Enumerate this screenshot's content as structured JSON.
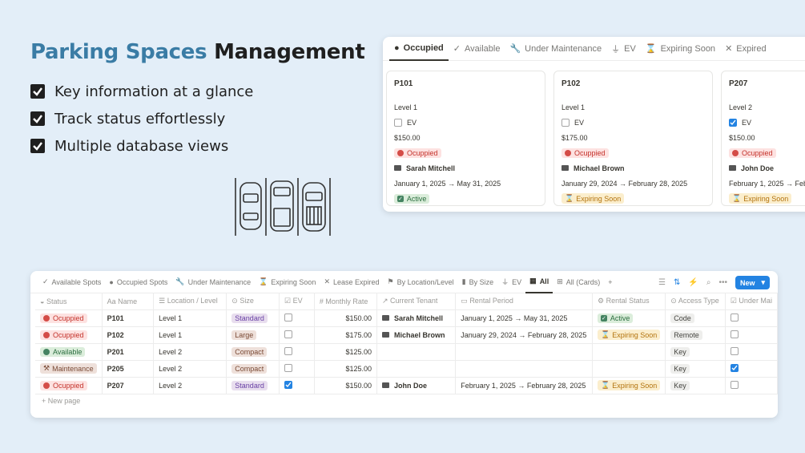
{
  "hero": {
    "title_part1": "Parking Spaces",
    "title_part2": "Management",
    "features": [
      "Key information at a glance",
      "Track status effortlessly",
      "Multiple database views"
    ]
  },
  "board": {
    "tabs": [
      {
        "label": "Occupied",
        "icon": "filled-circle-icon",
        "active": true
      },
      {
        "label": "Available",
        "icon": "check-icon"
      },
      {
        "label": "Under Maintenance",
        "icon": "wrench-icon"
      },
      {
        "label": "EV",
        "icon": "plug-icon"
      },
      {
        "label": "Expiring Soon",
        "icon": "hourglass-icon"
      },
      {
        "label": "Expired",
        "icon": "x-icon"
      }
    ],
    "cards": [
      {
        "name": "P101",
        "level": "Level 1",
        "ev_label": "EV",
        "ev": false,
        "price": "$150.00",
        "status": "Ocuppied",
        "tenant": "Sarah Mitchell",
        "period": "January 1, 2025 → May 31, 2025",
        "rental": "Active"
      },
      {
        "name": "P102",
        "level": "Level 1",
        "ev_label": "EV",
        "ev": false,
        "price": "$175.00",
        "status": "Ocuppied",
        "tenant": "Michael Brown",
        "period": "January 29, 2024 → February 28, 2025",
        "rental": "Expiring Soon"
      },
      {
        "name": "P207",
        "level": "Level 2",
        "ev_label": "EV",
        "ev": true,
        "price": "$150.00",
        "status": "Ocuppied",
        "tenant": "John Doe",
        "period": "February 1, 2025 → Febr",
        "rental": "Expiring Soon"
      }
    ]
  },
  "table": {
    "view_tabs": [
      {
        "label": "Available Spots",
        "icon": "check-icon"
      },
      {
        "label": "Occupied Spots",
        "icon": "filled-circle-icon"
      },
      {
        "label": "Under Maintenance",
        "icon": "wrench-icon"
      },
      {
        "label": "Expiring Soon",
        "icon": "hourglass-icon"
      },
      {
        "label": "Lease Expired",
        "icon": "x-icon"
      },
      {
        "label": "By Location/Level",
        "icon": "flag-icon"
      },
      {
        "label": "By Size",
        "icon": "bar-icon"
      },
      {
        "label": "EV",
        "icon": "plug-icon"
      },
      {
        "label": "All",
        "icon": "table-icon",
        "active": true
      },
      {
        "label": "All (Cards)",
        "icon": "grid-icon"
      }
    ],
    "new_button": "New",
    "columns": [
      "Status",
      "Name",
      "Location / Level",
      "Size",
      "EV",
      "Monthly Rate",
      "Current Tenant",
      "Rental Period",
      "Rental Status",
      "Access Type",
      "Under Mai"
    ],
    "rows": [
      {
        "status": "Ocuppied",
        "status_color": "red",
        "name": "P101",
        "level": "Level 1",
        "size": "Standard",
        "ev": false,
        "rate": "$150.00",
        "tenant": "Sarah Mitchell",
        "period": "January 1, 2025 → May 31, 2025",
        "rental": "Active",
        "access": "Code",
        "maint": false
      },
      {
        "status": "Ocuppied",
        "status_color": "red",
        "name": "P102",
        "level": "Level 1",
        "size": "Large",
        "ev": false,
        "rate": "$175.00",
        "tenant": "Michael Brown",
        "period": "January 29, 2024 → February 28, 2025",
        "rental": "Expiring Soon",
        "access": "Remote",
        "maint": false
      },
      {
        "status": "Available",
        "status_color": "green",
        "name": "P201",
        "level": "Level 2",
        "size": "Compact",
        "ev": false,
        "rate": "$125.00",
        "tenant": "",
        "period": "",
        "rental": "",
        "access": "Key",
        "maint": false
      },
      {
        "status": "Maintenance",
        "status_color": "orange",
        "name": "P205",
        "level": "Level 2",
        "size": "Compact",
        "ev": false,
        "rate": "$125.00",
        "tenant": "",
        "period": "",
        "rental": "",
        "access": "Key",
        "maint": true
      },
      {
        "status": "Ocuppied",
        "status_color": "red",
        "name": "P207",
        "level": "Level 2",
        "size": "Standard",
        "ev": true,
        "rate": "$150.00",
        "tenant": "John Doe",
        "period": "February 1, 2025 → February 28, 2025",
        "rental": "Expiring Soon",
        "access": "Key",
        "maint": false
      }
    ],
    "new_page": "New page"
  }
}
